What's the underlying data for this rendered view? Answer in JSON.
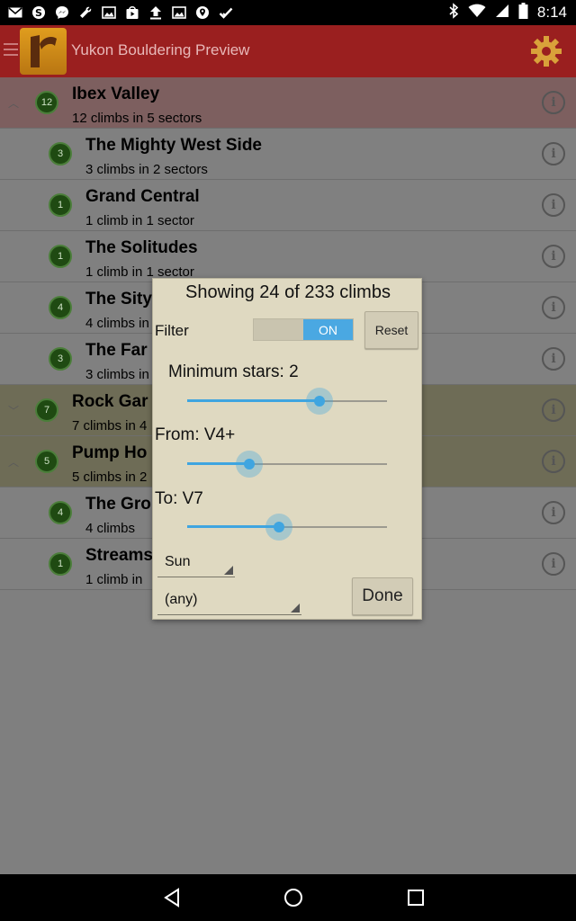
{
  "status_bar": {
    "left_icons": [
      "gmail-icon",
      "skype-icon",
      "messenger-icon",
      "wrench-icon",
      "image-icon",
      "play-store-icon",
      "upload-icon",
      "image-icon",
      "location-icon",
      "checked-icon"
    ],
    "time": "8:14",
    "right_icons": [
      "bluetooth-icon",
      "wifi-icon",
      "signal-icon",
      "battery-icon"
    ]
  },
  "app_bar": {
    "title": "Yukon Bouldering Preview",
    "color": "#9a1f1f"
  },
  "list": {
    "items": [
      {
        "count": "12",
        "title": "Ibex Valley",
        "subtitle": "12 climbs in 5 sectors",
        "kind": "area",
        "expanded": true
      },
      {
        "count": "3",
        "title": "The Mighty West Side",
        "subtitle": "3 climbs in 2 sectors",
        "kind": "sub"
      },
      {
        "count": "1",
        "title": "Grand Central",
        "subtitle": "1 climb in 1 sector",
        "kind": "sub"
      },
      {
        "count": "1",
        "title": "The Solitudes",
        "subtitle": "1 climb in 1 sector",
        "kind": "sub"
      },
      {
        "count": "4",
        "title": "The Sity",
        "subtitle": "4 climbs in",
        "kind": "sub"
      },
      {
        "count": "3",
        "title": "The Far",
        "subtitle": "3 climbs in",
        "kind": "sub"
      },
      {
        "count": "7",
        "title": "Rock Gar",
        "subtitle": "7 climbs in 4",
        "kind": "area",
        "expanded": false
      },
      {
        "count": "5",
        "title": "Pump Ho",
        "subtitle": "5 climbs in 2",
        "kind": "area",
        "expanded": true
      },
      {
        "count": "4",
        "title": "The Gro",
        "subtitle": "4 climbs",
        "kind": "sub"
      },
      {
        "count": "1",
        "title": "Streams",
        "subtitle": "1 climb in",
        "kind": "sub"
      }
    ]
  },
  "dialog": {
    "title": "Showing 24 of 233 climbs",
    "filter_label": "Filter",
    "toggle_state": "ON",
    "reset_label": "Reset",
    "min_stars_label": "Minimum stars: 2",
    "min_stars_fraction": 0.66,
    "from_label": "From: V4+",
    "from_fraction": 0.31,
    "to_label": "To: V7",
    "to_fraction": 0.46,
    "day_value": "Sun",
    "any_value": "(any)",
    "done_label": "Done",
    "accent": "#3fa5e0"
  }
}
